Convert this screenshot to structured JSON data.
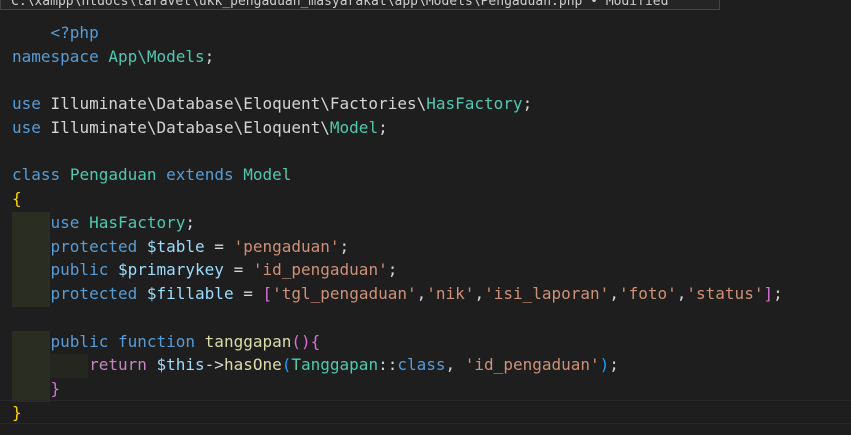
{
  "tooltip": {
    "text": "C:\\xampp\\htdocs\\laravel\\ukk_pengaduan_masyarakat\\app\\Models\\Pengaduan.php • Modified"
  },
  "code": {
    "open_tag": "<?php",
    "namespace_kw": "namespace",
    "namespace_name": "App\\Models",
    "semicolon": ";",
    "use_kw": "use",
    "use1_path": "Illuminate\\Database\\Eloquent\\Factories\\",
    "use1_class": "HasFactory",
    "use2_path": "Illuminate\\Database\\Eloquent\\",
    "use2_class": "Model",
    "class_kw": "class",
    "class_name": "Pengaduan",
    "extends_kw": "extends",
    "extends_name": "Model",
    "open_brace": "{",
    "close_brace": "}",
    "trait": "HasFactory",
    "protected_kw": "protected",
    "public_kw": "public",
    "table_var": "$table",
    "table_val": "'pengaduan'",
    "pk_var": "$primarykey",
    "pk_val": "'id_pengaduan'",
    "fillable_var": "$fillable",
    "fillable_items": [
      "'tgl_pengaduan'",
      "'nik'",
      "'isi_laporan'",
      "'foto'",
      "'status'"
    ],
    "assign": " = ",
    "function_kw": "function",
    "method_name": "tanggapan",
    "return_kw": "return",
    "this_var": "$this",
    "arrow": "->",
    "has_one": "hasOne",
    "related_class": "Tanggapan",
    "scope_op": "::",
    "class_const": "class",
    "fk_val": "'id_pengaduan'"
  }
}
